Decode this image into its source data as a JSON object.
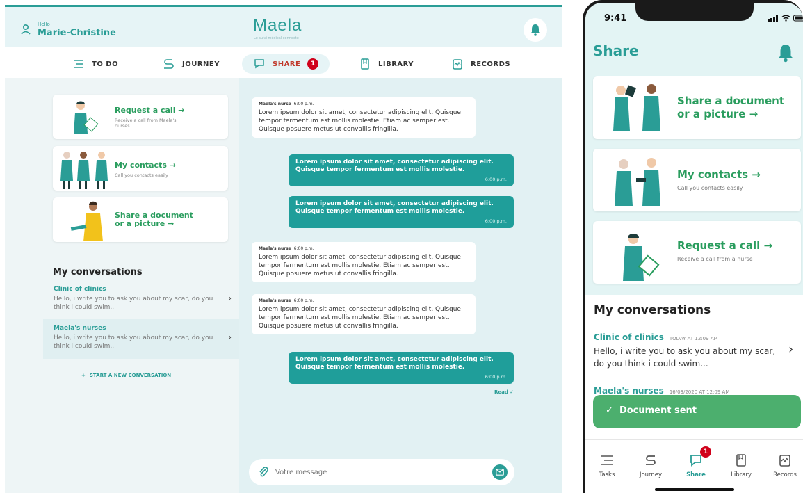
{
  "tablet": {
    "header": {
      "greeting": "Hello",
      "user_name": "Marie-Christine",
      "logo": "Maela",
      "logo_tagline": "Le suivi médical connecté"
    },
    "nav": {
      "items": [
        {
          "label": "TO DO",
          "icon": "list-icon"
        },
        {
          "label": "JOURNEY",
          "icon": "journey-icon"
        },
        {
          "label": "SHARE",
          "icon": "chat-icon",
          "badge": "1"
        },
        {
          "label": "LIBRARY",
          "icon": "book-icon"
        },
        {
          "label": "RECORDS",
          "icon": "records-icon"
        }
      ]
    },
    "cards": [
      {
        "title": "Request a call →",
        "subtitle": "Receive a call from Maela's nurses"
      },
      {
        "title": "My contacts →",
        "subtitle": "Call you contacts easily"
      },
      {
        "title": "Share a document\nor a picture →",
        "subtitle": ""
      }
    ],
    "conversations": {
      "title": "My conversations",
      "items": [
        {
          "name": "Clinic of clinics",
          "preview": "Hello, i write you to ask you about my scar, do you think i could swim..."
        },
        {
          "name": "Maela's nurses",
          "preview": "Hello, i write you to ask you about my scar, do you think i could swim..."
        }
      ],
      "new_label": "START A NEW CONVERSATION"
    },
    "messages": [
      {
        "dir": "in",
        "sender": "Maela's nurse",
        "time": "6:00 p.m.",
        "text": "Lorem ipsum dolor sit amet, consectetur adipiscing elit. Quisque tempor fermentum est mollis molestie. Etiam ac semper est. Quisque posuere metus ut convallis fringilla."
      },
      {
        "dir": "out",
        "time": "6:00 p.m.",
        "text": "Lorem ipsum dolor sit amet, consectetur adipiscing elit. Quisque tempor fermentum est mollis molestie."
      },
      {
        "dir": "out",
        "time": "6:00 p.m.",
        "text": "Lorem ipsum dolor sit amet, consectetur adipiscing elit. Quisque tempor fermentum est mollis molestie."
      },
      {
        "dir": "in",
        "sender": "Maela's nurse",
        "time": "6:00 p.m.",
        "text": "Lorem ipsum dolor sit amet, consectetur adipiscing elit. Quisque tempor fermentum est mollis molestie. Etiam ac semper est. Quisque posuere metus ut convallis fringilla."
      },
      {
        "dir": "in",
        "sender": "Maela's nurse",
        "time": "6:00 p.m.",
        "text": "Lorem ipsum dolor sit amet, consectetur adipiscing elit. Quisque tempor fermentum est mollis molestie. Etiam ac semper est. Quisque posuere metus ut convallis fringilla."
      },
      {
        "dir": "out",
        "time": "6:00 p.m.",
        "text": "Lorem ipsum dolor sit amet, consectetur adipiscing elit. Quisque tempor fermentum est mollis molestie."
      }
    ],
    "read_label": "Read ✓",
    "input_placeholder": "Votre message"
  },
  "phone": {
    "time": "9:41",
    "title": "Share",
    "cards": [
      {
        "title": "Share a document or a picture →",
        "subtitle": ""
      },
      {
        "title": "My contacts →",
        "subtitle": "Call you contacts easily"
      },
      {
        "title": "Request a call →",
        "subtitle": "Receive a call from a nurse"
      }
    ],
    "conversations_title": "My conversations",
    "conversations": [
      {
        "name": "Clinic of clinics",
        "timestamp": "TODAY AT 12:09 AM",
        "preview": "Hello, i write you to ask you about my scar, do you think i could swim..."
      },
      {
        "name": "Maela's nurses",
        "timestamp": "16/03/2020 AT 12:09 AM"
      }
    ],
    "toast": "✓  Document sent",
    "tabs": [
      {
        "label": "Tasks",
        "icon": "list-icon"
      },
      {
        "label": "Journey",
        "icon": "journey-icon"
      },
      {
        "label": "Share",
        "icon": "chat-icon",
        "badge": "1"
      },
      {
        "label": "Library",
        "icon": "book-icon"
      },
      {
        "label": "Records",
        "icon": "records-icon"
      }
    ]
  },
  "colors": {
    "accent": "#2a9d96",
    "green": "#2a9d5e",
    "toast": "#4caf6e",
    "badge": "#d0021b"
  }
}
